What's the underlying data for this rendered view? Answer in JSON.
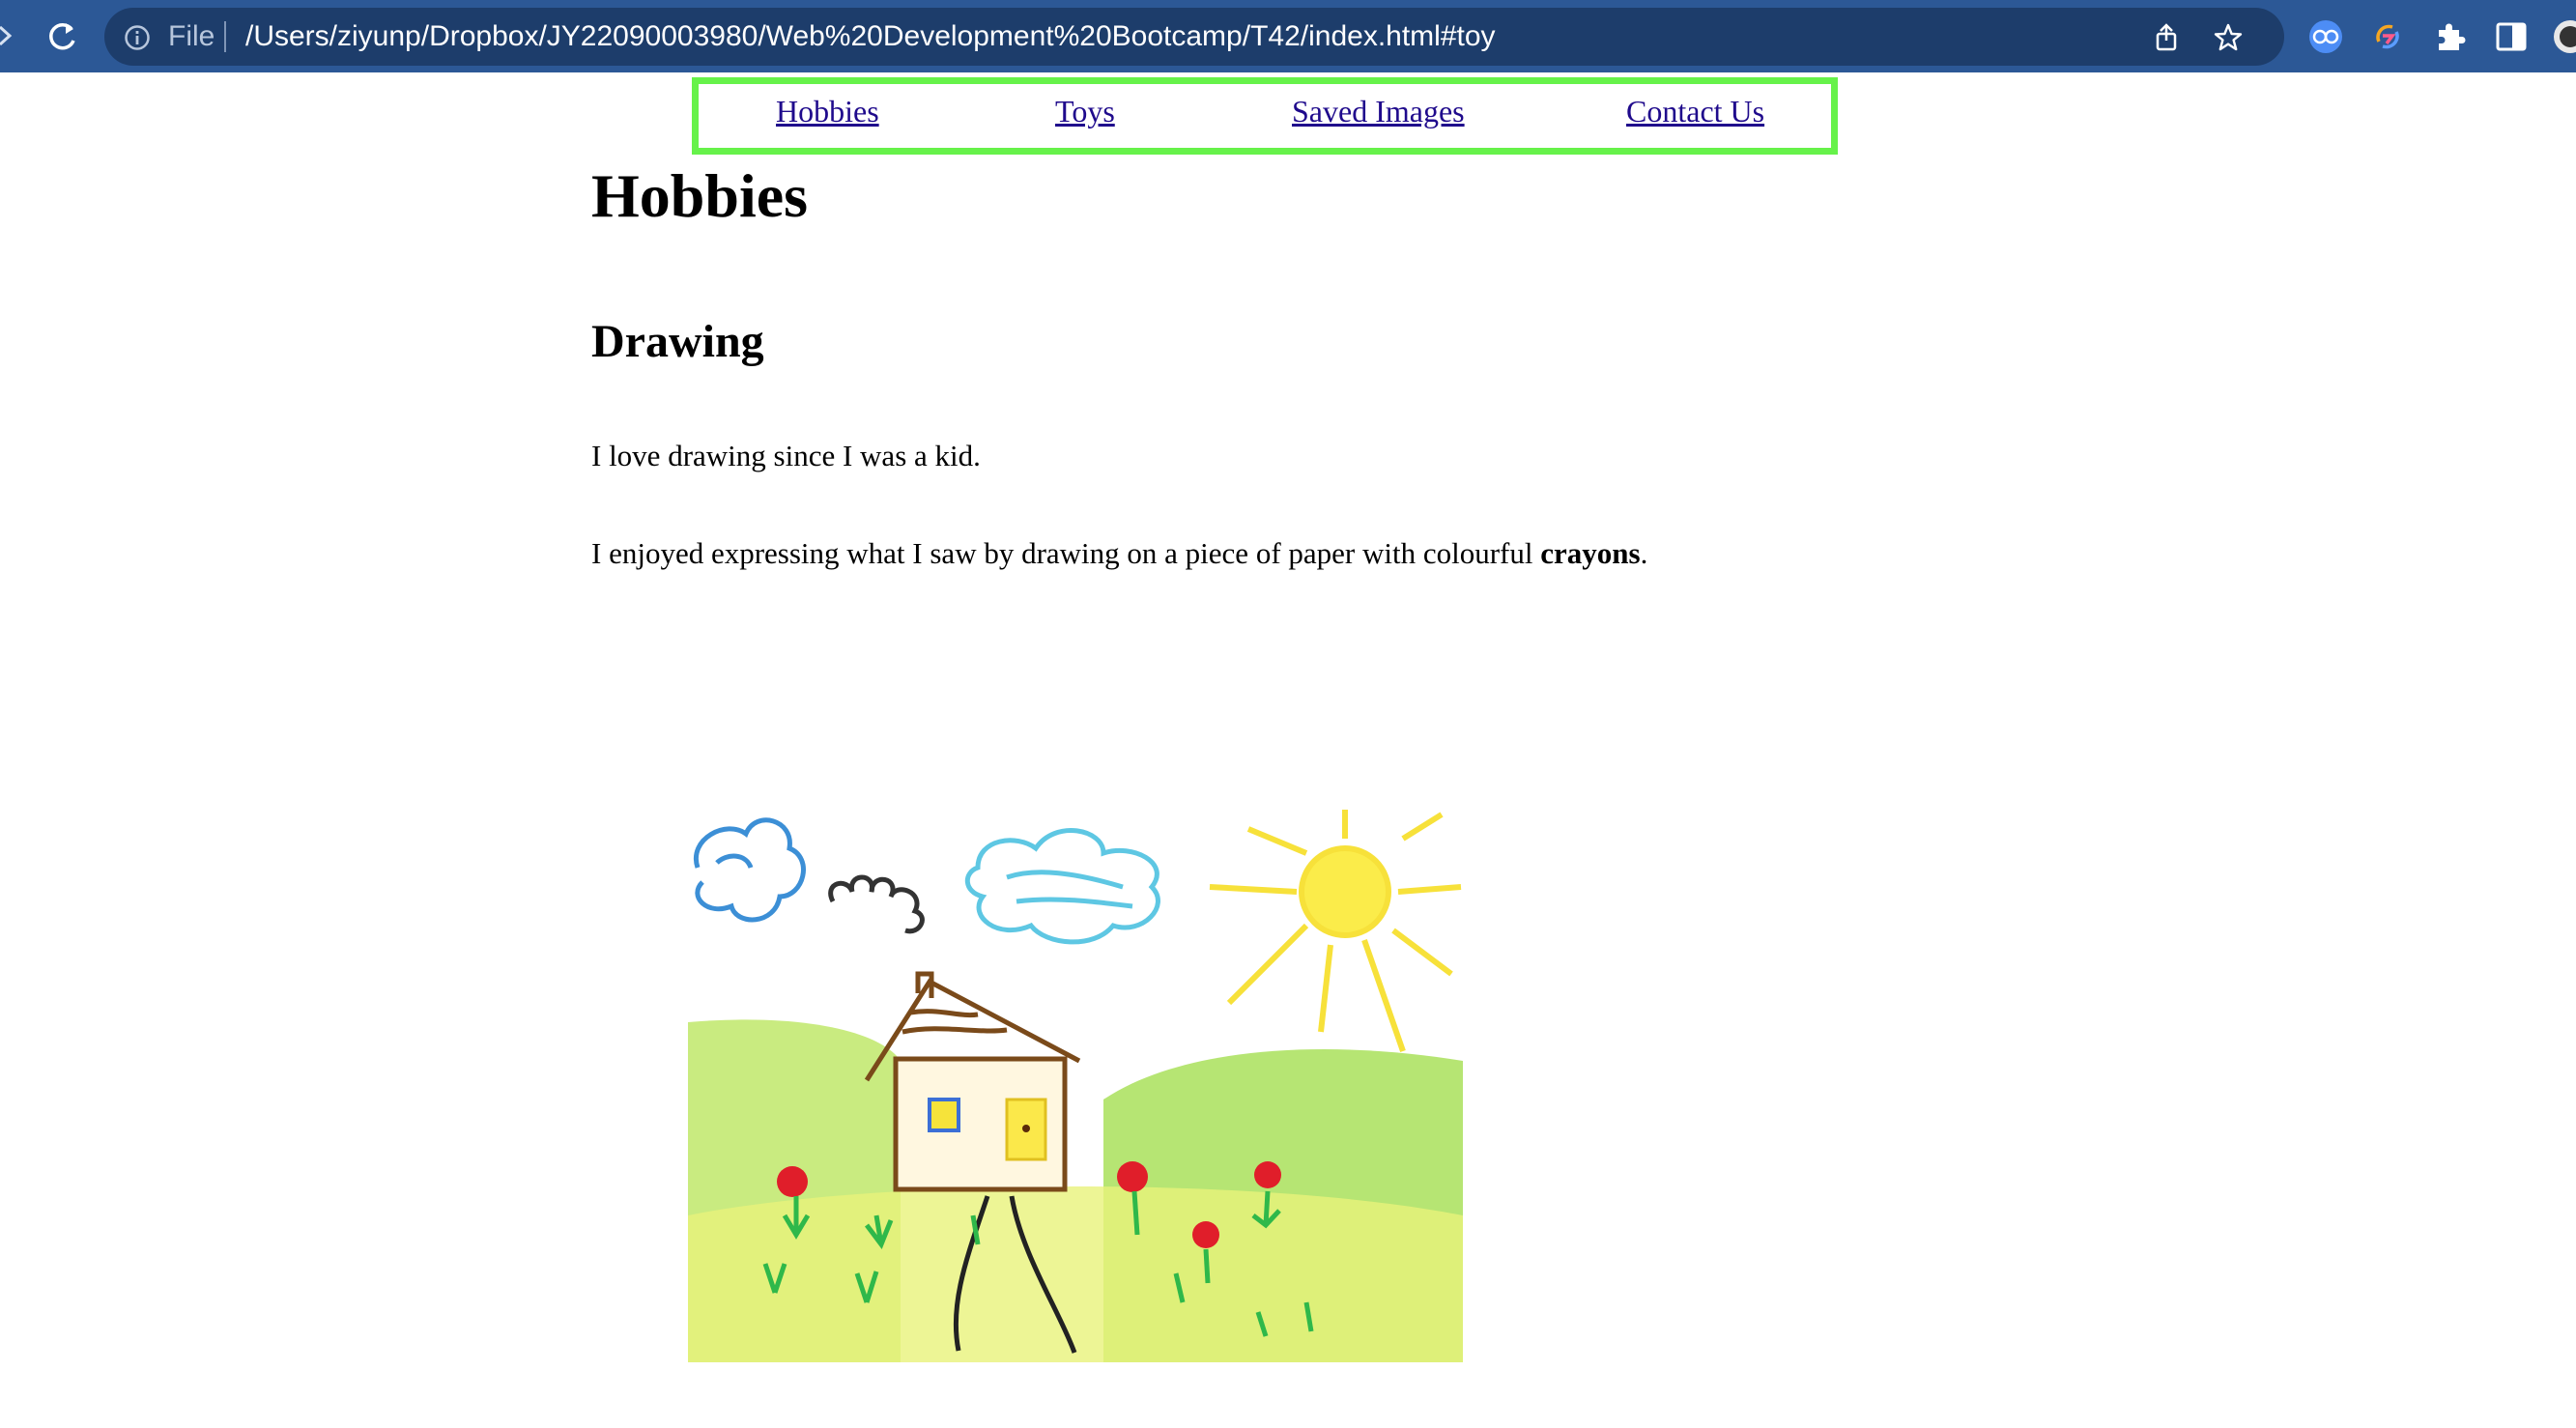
{
  "browser": {
    "scheme_label": "File",
    "url": "/Users/ziyunp/Dropbox/JY22090003980/Web%20Development%20Bootcamp/T42/index.html#toy",
    "icons": [
      "reload-icon",
      "info-icon",
      "share-icon",
      "star-icon",
      "translate-icon",
      "sync-icon",
      "extensions-icon",
      "side-panel-icon",
      "profile-avatar"
    ]
  },
  "nav": {
    "links": [
      "Hobbies",
      "Toys",
      "Saved Images",
      "Contact Us"
    ],
    "border_color": "#66f24a",
    "link_color": "#1f0a8c"
  },
  "page": {
    "title": "Hobbies",
    "section_heading": "Drawing",
    "paragraph1": "I love drawing since I was a kid.",
    "paragraph2_before": "I enjoyed expressing what I saw by drawing on a piece of paper with colourful ",
    "paragraph2_bold": "crayons",
    "paragraph2_after": "."
  },
  "image": {
    "description_icon": "crayon-house-drawing"
  }
}
